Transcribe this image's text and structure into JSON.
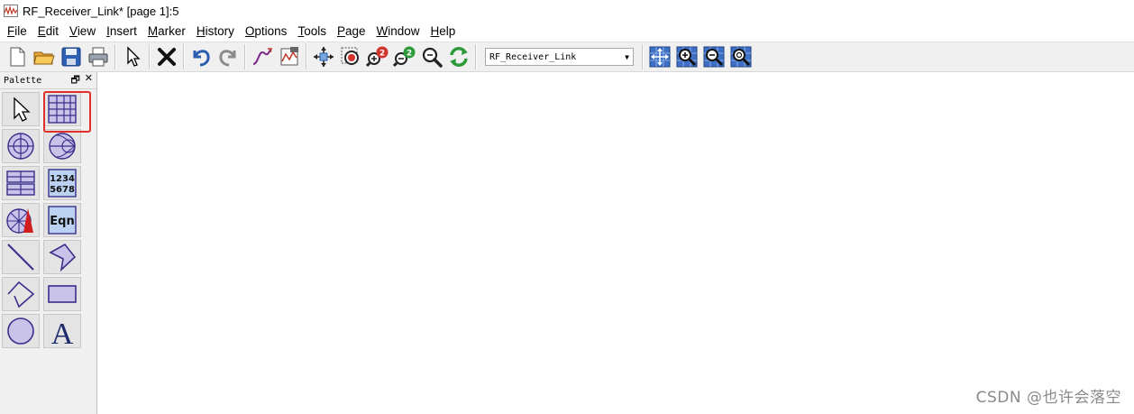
{
  "window": {
    "title": "RF_Receiver_Link* [page 1]:5",
    "app_icon": "waveform-icon"
  },
  "menu": {
    "items": [
      {
        "label": "File",
        "u": "F"
      },
      {
        "label": "Edit",
        "u": "E"
      },
      {
        "label": "View",
        "u": "V"
      },
      {
        "label": "Insert",
        "u": "I"
      },
      {
        "label": "Marker",
        "u": "M"
      },
      {
        "label": "History",
        "u": "H"
      },
      {
        "label": "Options",
        "u": "O"
      },
      {
        "label": "Tools",
        "u": "T"
      },
      {
        "label": "Page",
        "u": "P"
      },
      {
        "label": "Window",
        "u": "W"
      },
      {
        "label": "Help",
        "u": "H"
      }
    ]
  },
  "toolbar": {
    "dataset_combo": "RF_Receiver_Link",
    "buttons": [
      "new-page-icon",
      "open-folder-icon",
      "save-icon",
      "print-icon",
      "select-pointer-icon",
      "delete-icon",
      "undo-icon",
      "redo-icon",
      "curve-icon",
      "plot-properties-icon",
      "move-icon",
      "zoom-box-icon",
      "zoom-in-2-icon",
      "zoom-out-2-icon",
      "zoom-reset-icon",
      "refresh-icon",
      "pan-view-icon",
      "view-zoom-in-icon",
      "view-zoom-out-icon",
      "view-zoom-fit-icon"
    ]
  },
  "palette": {
    "title": "Palette",
    "float_glyph": "🗗",
    "close_glyph": "✕",
    "tools": [
      "arrow-pointer-icon",
      "rectangular-plot-icon",
      "polar-plot-icon",
      "smith-chart-icon",
      "list-table-icon",
      "stack-numbers-icon",
      "antenna-plot-icon",
      "equation-icon",
      "line-draw-icon",
      "polygon-draw-icon",
      "polyline-draw-icon",
      "rectangle-draw-icon",
      "circle-draw-icon",
      "text-draw-icon"
    ],
    "num_label_1": "1234",
    "num_label_2": "5678",
    "eqn_label": "Eqn",
    "text_tool_label": "A",
    "selected_tool": "rectangular-plot-icon",
    "highlight_color": "#e0302b"
  },
  "watermark": "CSDN @也许会落空"
}
